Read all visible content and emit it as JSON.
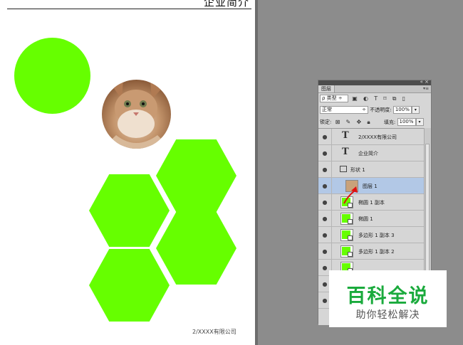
{
  "document": {
    "title": "企业简介",
    "footer": "2/XXXX有限公司",
    "shape_color": "#66ff00"
  },
  "layers_panel": {
    "tab_label": "图层",
    "filter_label": "ρ 类型",
    "blend_mode": "正常",
    "opacity_label": "不透明度:",
    "opacity_value": "100%",
    "lock_label": "锁定:",
    "fill_label": "填充:",
    "fill_value": "100%",
    "layers": [
      {
        "name": "2/XXXX有限公司",
        "kind": "text"
      },
      {
        "name": "企业简介",
        "kind": "text"
      },
      {
        "name": "形状 1",
        "kind": "group"
      },
      {
        "name": "图层 1",
        "kind": "image",
        "selected": true
      },
      {
        "name": "椭圆 1 副本",
        "kind": "shape"
      },
      {
        "name": "椭圆 1",
        "kind": "shape"
      },
      {
        "name": "多边形 1 副本 3",
        "kind": "shape"
      },
      {
        "name": "多边形 1 副本 2",
        "kind": "shape"
      },
      {
        "name": "",
        "kind": "shape"
      },
      {
        "name": "",
        "kind": "shape"
      },
      {
        "name": "",
        "kind": "shape"
      }
    ]
  },
  "watermark": {
    "main": "百科全说",
    "sub": "助你轻松解决",
    "color": "#1aaa3c"
  }
}
